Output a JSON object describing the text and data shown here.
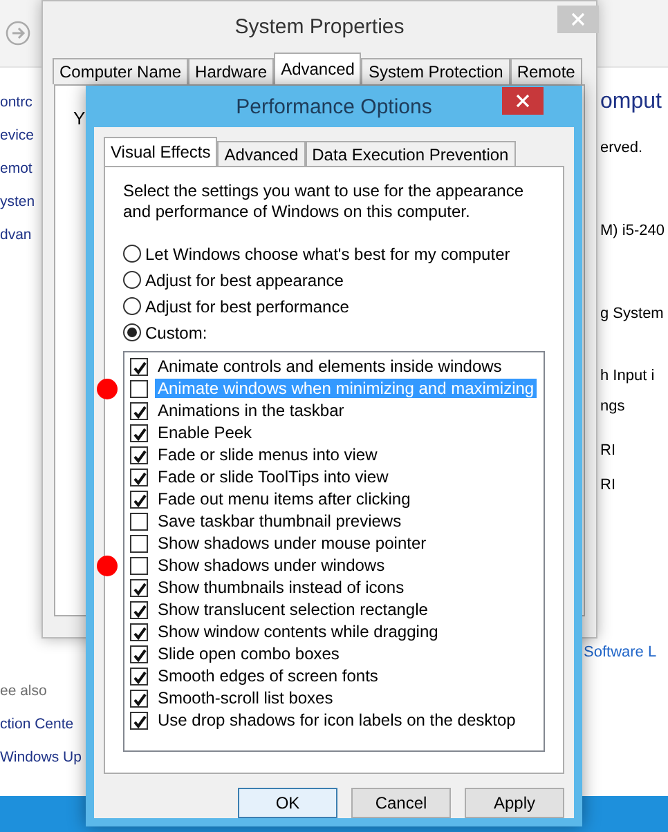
{
  "background_window": {
    "left_links": [
      "ontrc",
      "evice",
      "emot",
      "ysten",
      "dvan"
    ],
    "see_also_heading": "ee also",
    "see_also_links": [
      "ction Cente",
      "Windows Up"
    ],
    "right_texts": [
      "omput",
      "erved.",
      "M) i5-240",
      "g System",
      "h Input i",
      "ngs",
      "RI",
      "RI"
    ],
    "right_link": "Software L"
  },
  "system_properties": {
    "title": "System Properties",
    "tabs": [
      {
        "label": "Computer Name",
        "selected": false
      },
      {
        "label": "Hardware",
        "selected": false
      },
      {
        "label": "Advanced",
        "selected": true
      },
      {
        "label": "System Protection",
        "selected": false
      },
      {
        "label": "Remote",
        "selected": false
      }
    ],
    "text": "Y"
  },
  "performance_options": {
    "title": "Performance Options",
    "tabs": [
      {
        "label": "Visual Effects",
        "selected": true
      },
      {
        "label": "Advanced",
        "selected": false
      },
      {
        "label": "Data Execution Prevention",
        "selected": false
      }
    ],
    "description": "Select the settings you want to use for the appearance and performance of Windows on this computer.",
    "options": [
      {
        "label": "Let Windows choose what's best for my computer",
        "selected": false
      },
      {
        "label": "Adjust for best appearance",
        "selected": false
      },
      {
        "label": "Adjust for best performance",
        "selected": false
      },
      {
        "label": "Custom:",
        "selected": true
      }
    ],
    "effects": [
      {
        "label": "Animate controls and elements inside windows",
        "checked": true,
        "selected": false,
        "marked": false
      },
      {
        "label": "Animate windows when minimizing and maximizing",
        "checked": false,
        "selected": true,
        "marked": true
      },
      {
        "label": "Animations in the taskbar",
        "checked": true,
        "selected": false,
        "marked": false
      },
      {
        "label": "Enable Peek",
        "checked": true,
        "selected": false,
        "marked": false
      },
      {
        "label": "Fade or slide menus into view",
        "checked": true,
        "selected": false,
        "marked": false
      },
      {
        "label": "Fade or slide ToolTips into view",
        "checked": true,
        "selected": false,
        "marked": false
      },
      {
        "label": "Fade out menu items after clicking",
        "checked": true,
        "selected": false,
        "marked": false
      },
      {
        "label": "Save taskbar thumbnail previews",
        "checked": false,
        "selected": false,
        "marked": false
      },
      {
        "label": "Show shadows under mouse pointer",
        "checked": false,
        "selected": false,
        "marked": false
      },
      {
        "label": "Show shadows under windows",
        "checked": false,
        "selected": false,
        "marked": true
      },
      {
        "label": "Show thumbnails instead of icons",
        "checked": true,
        "selected": false,
        "marked": false
      },
      {
        "label": "Show translucent selection rectangle",
        "checked": true,
        "selected": false,
        "marked": false
      },
      {
        "label": "Show window contents while dragging",
        "checked": true,
        "selected": false,
        "marked": false
      },
      {
        "label": "Slide open combo boxes",
        "checked": true,
        "selected": false,
        "marked": false
      },
      {
        "label": "Smooth edges of screen fonts",
        "checked": true,
        "selected": false,
        "marked": false
      },
      {
        "label": "Smooth-scroll list boxes",
        "checked": true,
        "selected": false,
        "marked": false
      },
      {
        "label": "Use drop shadows for icon labels on the desktop",
        "checked": true,
        "selected": false,
        "marked": false
      }
    ],
    "buttons": [
      {
        "label": "OK",
        "default": true
      },
      {
        "label": "Cancel",
        "default": false
      },
      {
        "label": "Apply",
        "default": false
      }
    ]
  }
}
